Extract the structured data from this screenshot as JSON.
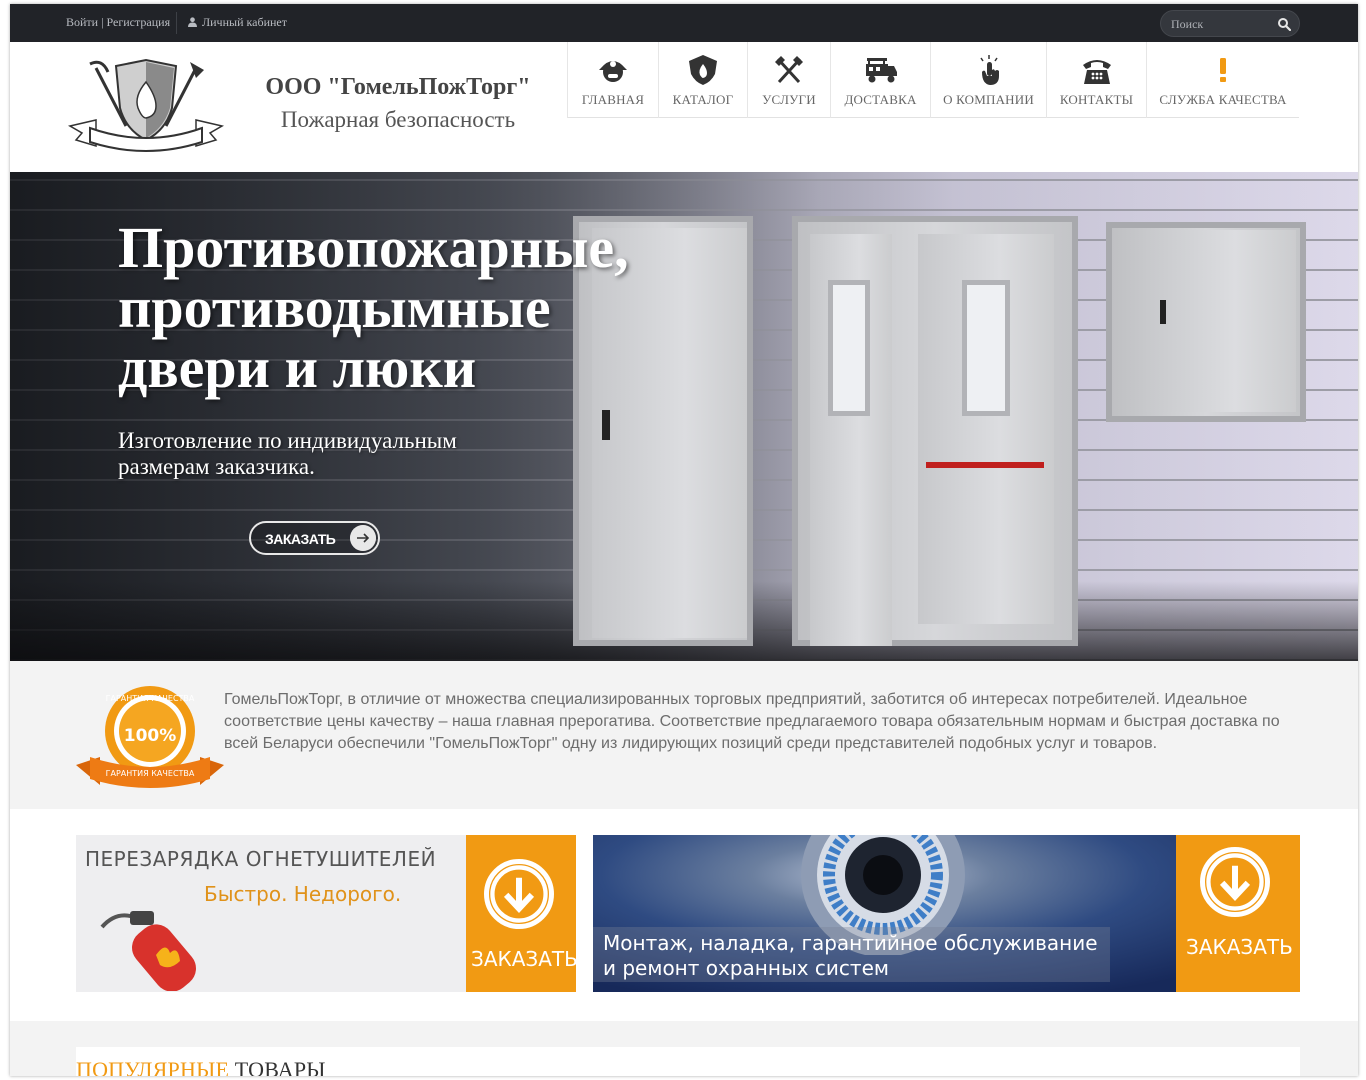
{
  "topbar": {
    "login": "Войти",
    "divider": "|",
    "register": "Регистрация",
    "cabinet": "Личный кабинет",
    "search_placeholder": "Поиск"
  },
  "header": {
    "logo_text": "ГомельПожТорг",
    "company_name": "ООО \"ГомельПожТорг\"",
    "tagline": "Пожарная безопасность"
  },
  "nav": [
    {
      "label": "ГЛАВНАЯ",
      "icon": "firefighter-helmet-icon"
    },
    {
      "label": "КАТАЛОГ",
      "icon": "fire-shield-icon"
    },
    {
      "label": "УСЛУГИ",
      "icon": "crossed-axes-icon"
    },
    {
      "label": "ДОСТАВКА",
      "icon": "fire-truck-icon"
    },
    {
      "label": "О КОМПАНИИ",
      "icon": "hand-pointer-icon"
    },
    {
      "label": "КОНТАКТЫ",
      "icon": "telephone-icon"
    },
    {
      "label": "СЛУЖБА КАЧЕСТВА",
      "icon": "exclamation-icon"
    }
  ],
  "hero": {
    "title": "Противопожарные, противодымные двери и люки",
    "subtitle": "Изготовление по индивидуальным размерам заказчика.",
    "button": "ЗАКАЗАТЬ"
  },
  "info": {
    "badge_top": "ГАРАНТИЯ КАЧЕСТВА",
    "badge_percent": "100%",
    "badge_bottom": "ГАРАНТИЯ КАЧЕСТВА",
    "text": "ГомельПожТорг, в отличие от множества специализированных торговых предприятий, заботится об интересах потребителей. Идеальное соответствие цены качеству – наша главная прерогатива. Соответствие предлагаемого товара обязательным нормам и быстрая доставка по всей Беларуси обеспечили \"ГомельПожТорг\" одну из лидирующих позиций среди представителей подобных услуг и товаров."
  },
  "banners": {
    "recharge_title": "ПЕРЕЗАРЯДКА ОГНЕТУШИТЕЛЕЙ",
    "recharge_sub": "Быстро. Недорого.",
    "recharge_button": "ЗАКАЗАТЬ",
    "security_line1": "Монтаж, наладка, гарантийное обслуживание",
    "security_line2": "и ремонт охранных систем",
    "security_button": "ЗАКАЗАТЬ"
  },
  "popular": {
    "highlight": "ПОПУЛЯРНЫЕ",
    "rest": " ТОВАРЫ"
  },
  "colors": {
    "accent": "#f19a13",
    "topbar": "#212328"
  }
}
